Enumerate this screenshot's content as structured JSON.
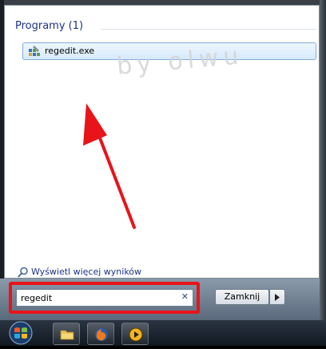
{
  "results": {
    "heading": "Programy (1)",
    "items": [
      {
        "label": "regedit.exe",
        "icon": "regedit-icon"
      }
    ]
  },
  "watermark": "by olwu",
  "see_more": {
    "label": "Wyświetl więcej wyników",
    "icon": "search-icon"
  },
  "search": {
    "value": "regedit",
    "clear_glyph": "✕"
  },
  "shutdown": {
    "label": "Zamknij",
    "arrow_icon": "chevron-right-icon"
  },
  "taskbar": {
    "start": "windows-orb-icon",
    "items": [
      "folder-icon",
      "firefox-icon",
      "media-player-icon"
    ]
  },
  "colors": {
    "highlight": "#e8141a",
    "link": "#1e3287",
    "arrow": "#e8141a"
  }
}
